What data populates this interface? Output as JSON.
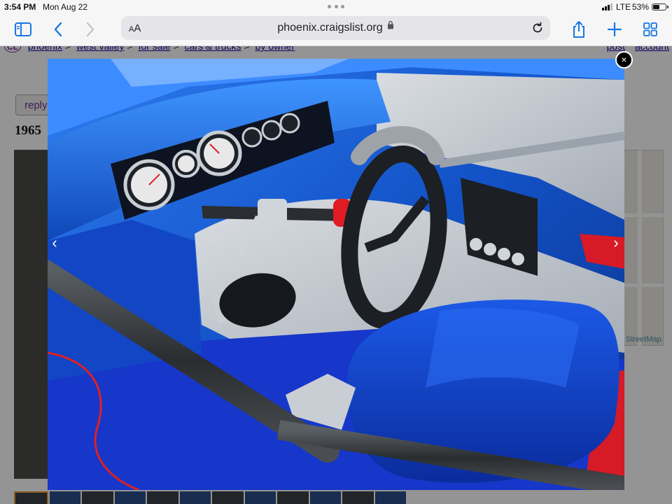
{
  "status_bar": {
    "time": "3:54 PM",
    "date": "Mon Aug 22",
    "carrier": "LTE",
    "battery_percent": "53%",
    "battery_level": 0.53
  },
  "toolbar": {
    "icons": [
      "sidebar-icon",
      "back-icon",
      "forward-icon",
      "share-icon",
      "new-tab-icon",
      "tabs-icon"
    ],
    "reader_label": "AA",
    "url": "phoenix.craigslist.org",
    "accent_color": "#1677e5"
  },
  "page": {
    "breadcrumbs": [
      "phoenix",
      "west valley",
      "for sale",
      "cars & trucks",
      "by owner"
    ],
    "top_links": [
      "post",
      "account"
    ],
    "reply_label": "reply",
    "title_fragment": "1965",
    "map_credit": "StreetMap"
  },
  "lightbox": {
    "close_glyph": "×",
    "prev_glyph": "‹",
    "next_glyph": "›",
    "image_subject": "race car interior"
  }
}
